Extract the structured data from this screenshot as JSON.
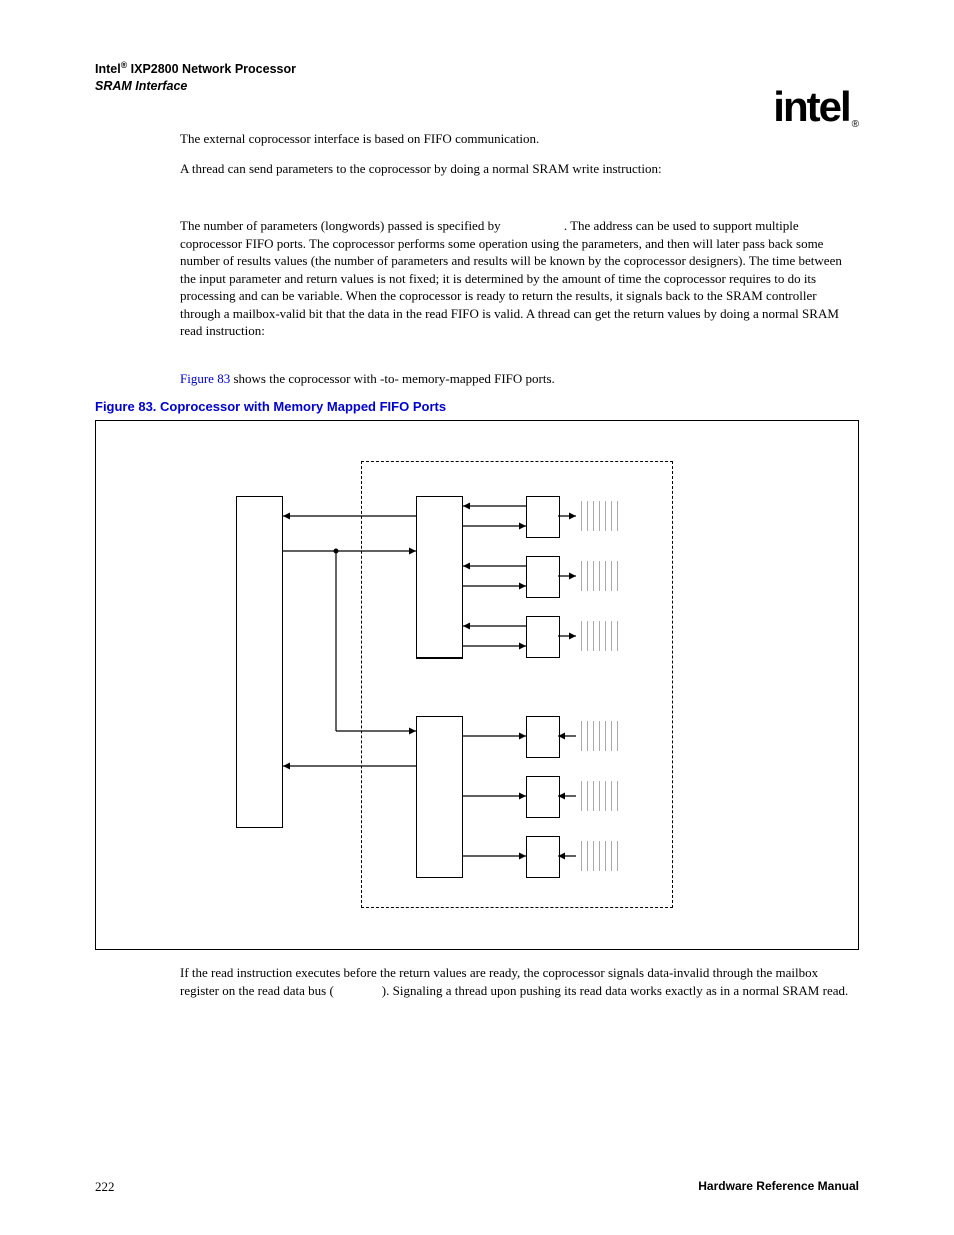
{
  "header": {
    "product_prefix": "Intel",
    "reg": "®",
    "product": " IXP2800 Network Processor",
    "subtitle": "SRAM Interface",
    "logo_text": "intel",
    "logo_reg": "®"
  },
  "body": {
    "p1": "The external coprocessor interface is based on FIFO communication.",
    "p2": "A thread can send parameters to the coprocessor by doing a normal SRAM write instruction:",
    "p3a": "The number of parameters (longwords) passed is specified by ",
    "p3b": ". The address can be used to support multiple coprocessor FIFO ports. The coprocessor performs some operation using the parameters, and then will later pass back some number of results values (the number of parameters and results will be known by the coprocessor designers). The time between the input parameter and return values is not fixed; it is determined by the amount of time the coprocessor requires to do its processing and can be variable. When the coprocessor is ready to return the results, it signals back to the SRAM controller through a mailbox-valid bit that the data in the read FIFO is valid. A thread can get the return values by doing a normal SRAM read instruction:",
    "p4_link": "Figure 83",
    "p4_rest": " shows the coprocessor with   -to-   memory-mapped FIFO ports.",
    "figure_caption": "Figure 83. Coprocessor with Memory Mapped FIFO Ports",
    "p5a": "If the read instruction executes before the return values are ready, the coprocessor signals data-invalid through the mailbox register on the read data bus (",
    "p5b": "). Signaling a thread upon pushing its read data works exactly as in a normal SRAM read."
  },
  "footer": {
    "page": "222",
    "right": "Hardware Reference Manual"
  }
}
